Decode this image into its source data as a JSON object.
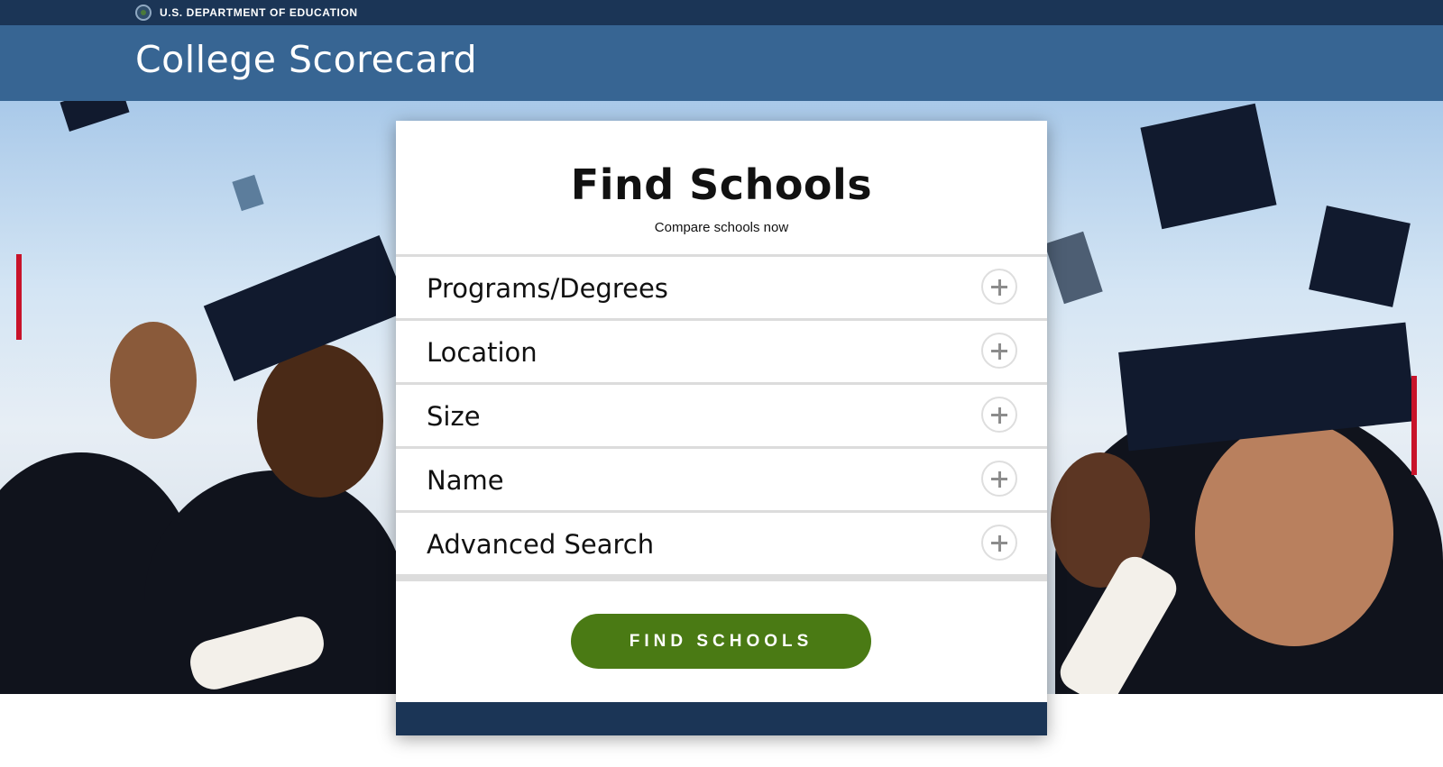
{
  "topbar": {
    "seal_icon": "department-seal-icon",
    "department": "U.S. DEPARTMENT OF EDUCATION"
  },
  "header": {
    "site_title": "College Scorecard"
  },
  "colors": {
    "topbar": "#1b3556",
    "header": "#376593",
    "button": "#4a7a14"
  },
  "search_panel": {
    "title": "Find Schools",
    "subtitle": "Compare schools now",
    "filters": [
      {
        "label": "Programs/Degrees",
        "icon": "plus-icon"
      },
      {
        "label": "Location",
        "icon": "plus-icon"
      },
      {
        "label": "Size",
        "icon": "plus-icon"
      },
      {
        "label": "Name",
        "icon": "plus-icon"
      },
      {
        "label": "Advanced Search",
        "icon": "plus-icon"
      }
    ],
    "button_label": "FIND SCHOOLS"
  }
}
